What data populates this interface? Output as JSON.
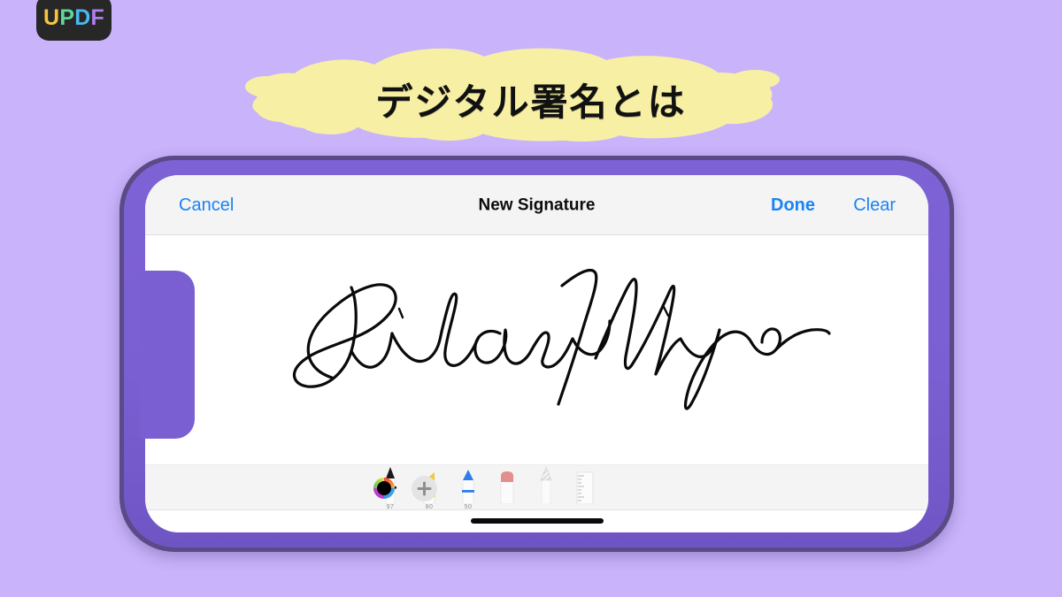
{
  "background": {
    "color": "#c9b3fb"
  },
  "logo": {
    "name": "UPDF",
    "letters": [
      {
        "char": "U",
        "color": "#f5c542"
      },
      {
        "char": "P",
        "color": "#5ed89a"
      },
      {
        "char": "D",
        "color": "#4ab8ef"
      },
      {
        "char": "F",
        "color": "#b07ef0"
      }
    ],
    "background": "#272727"
  },
  "title": {
    "text": "デジタル署名とは",
    "color": "#111111",
    "highlight_color": "#f7f0a4"
  },
  "phone": {
    "orientation": "landscape",
    "frame_color": "#7a5fd2",
    "rim_color": "#5a4a86",
    "screen_background": "#ffffff"
  },
  "screen": {
    "topbar": {
      "cancel_label": "Cancel",
      "title": "New Signature",
      "done_label": "Done",
      "clear_label": "Clear",
      "accent_color": "#1a83f5",
      "background": "#f4f4f4"
    },
    "canvas": {
      "signature_name": "Richard Nixon",
      "ink_color": "#0a0a0a",
      "background": "#ffffff"
    },
    "palette": {
      "background": "#f4f4f4",
      "tools": [
        {
          "name": "pen",
          "label": "97",
          "color": "#1a1a1a"
        },
        {
          "name": "highlighter",
          "label": "80",
          "color": "#f2c938"
        },
        {
          "name": "marker",
          "label": "50",
          "color": "#2f7de8"
        },
        {
          "name": "eraser",
          "label": "",
          "color": "#e58e8e"
        },
        {
          "name": "pencil",
          "label": "",
          "color": "#d6d6d6"
        },
        {
          "name": "ruler",
          "label": "",
          "color": "#e6e6e6"
        }
      ],
      "color_wheel": {
        "name": "color-wheel",
        "selected_color": "#000000"
      },
      "add_button": {
        "name": "add-color",
        "label": "+"
      }
    },
    "home_indicator": {
      "color": "#0a0a0a"
    }
  }
}
